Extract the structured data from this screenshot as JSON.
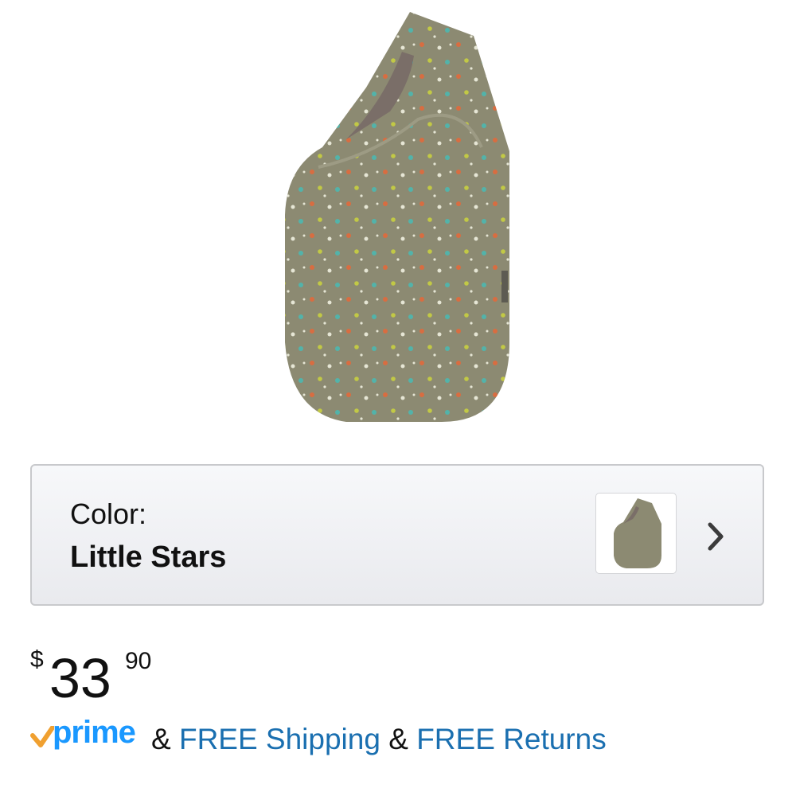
{
  "product": {
    "image_icon": "sleep-sack-image"
  },
  "color_selector": {
    "label": "Color:",
    "value": "Little Stars",
    "chevron_icon": "chevron-right-icon"
  },
  "price": {
    "currency": "$",
    "whole": "33",
    "fraction": "90"
  },
  "shipping": {
    "prime_logo_text": "prime",
    "amp1": "&",
    "free_shipping": "FREE Shipping",
    "amp2": "&",
    "free_returns": "FREE Returns"
  },
  "colors": {
    "link": "#1a6fb0",
    "prime_blue": "#1a98ff",
    "prime_check": "#f0a030",
    "fabric": "#8c8a72"
  }
}
